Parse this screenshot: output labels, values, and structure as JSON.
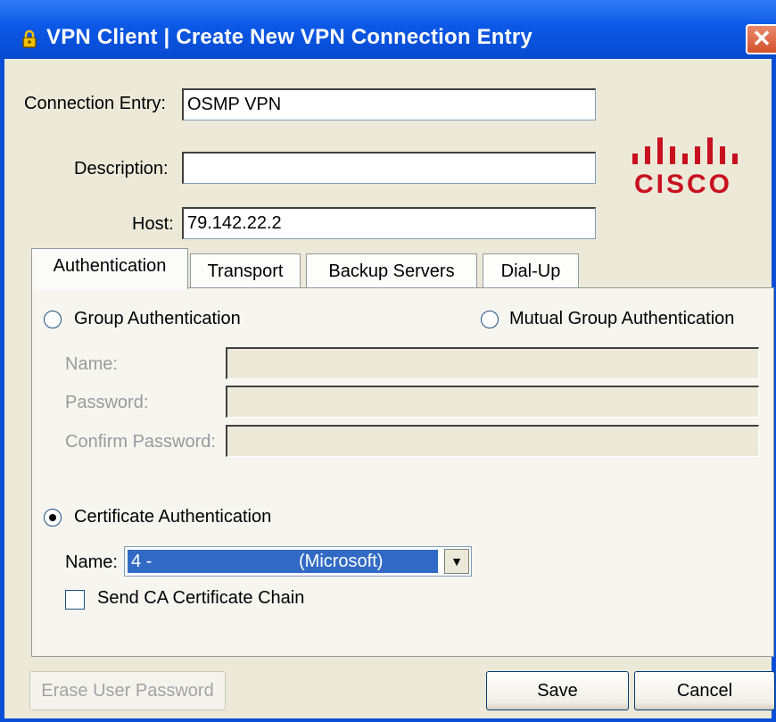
{
  "window": {
    "title": "VPN Client  |  Create New VPN Connection Entry",
    "close_glyph": "✕"
  },
  "form": {
    "connection_entry_label": "Connection Entry:",
    "connection_entry_value": "OSMP VPN",
    "description_label": "Description:",
    "description_value": "",
    "host_label": "Host:",
    "host_value": "79.142.22.2"
  },
  "logo": {
    "wordmark": "CISCO",
    "color": "#c8101f"
  },
  "tabs": [
    {
      "label": "Authentication",
      "active": true
    },
    {
      "label": "Transport",
      "active": false
    },
    {
      "label": "Backup Servers",
      "active": false
    },
    {
      "label": "Dial-Up",
      "active": false
    }
  ],
  "auth": {
    "group_auth_label": "Group Authentication",
    "group_auth_selected": false,
    "mutual_group_auth_label": "Mutual Group Authentication",
    "mutual_group_auth_selected": false,
    "name_label": "Name:",
    "password_label": "Password:",
    "confirm_password_label": "Confirm Password:",
    "cert_auth_label": "Certificate Authentication",
    "cert_auth_selected": true,
    "cert_name_label": "Name:",
    "cert_name_value_prefix": "4 -",
    "cert_name_value_suffix": "(Microsoft)",
    "send_ca_label": "Send CA Certificate Chain",
    "send_ca_checked": false
  },
  "buttons": {
    "erase_password": "Erase User Password",
    "save": "Save",
    "cancel": "Cancel"
  }
}
